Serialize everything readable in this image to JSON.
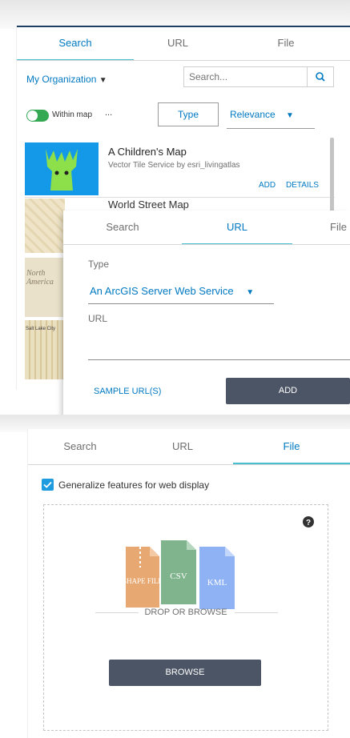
{
  "search_panel": {
    "tabs": [
      "Search",
      "URL",
      "File"
    ],
    "active_tab": 0,
    "organization_label": "My Organization",
    "search_placeholder": "Search...",
    "within_map_label": "Within map",
    "ellipsis": "...",
    "type_button": "Type",
    "sort_label": "Relevance",
    "results": [
      {
        "title": "A Children's Map",
        "subtitle": "Vector Tile Service by esri_livingatlas",
        "add": "ADD",
        "details": "DETAILS"
      },
      {
        "title": "World Street Map",
        "subtitle": "",
        "add": "",
        "details": ""
      },
      {
        "title": "North America",
        "subtitle": "",
        "add": "",
        "details": ""
      },
      {
        "title": "Salt Lake City",
        "subtitle": "",
        "add": "",
        "details": ""
      }
    ]
  },
  "url_panel": {
    "tabs": [
      "Search",
      "URL",
      "File"
    ],
    "active_tab": 1,
    "type_label": "Type",
    "type_value": "An ArcGIS Server Web Service",
    "url_label": "URL",
    "sample_link": "SAMPLE URL(S)",
    "add_button": "ADD"
  },
  "file_panel": {
    "tabs": [
      "Search",
      "URL",
      "File"
    ],
    "active_tab": 2,
    "generalize_label": "Generalize features for web display",
    "file_icons": [
      "SHAPE FILE",
      "CSV",
      "KML"
    ],
    "drop_text": "DROP OR BROWSE",
    "browse_button": "BROWSE",
    "colors": {
      "shape": "#e8a872",
      "csv": "#7fb48d",
      "kml": "#8fb2f4",
      "accent": "#0079c1",
      "tab_bar": "#48bfcf"
    }
  }
}
